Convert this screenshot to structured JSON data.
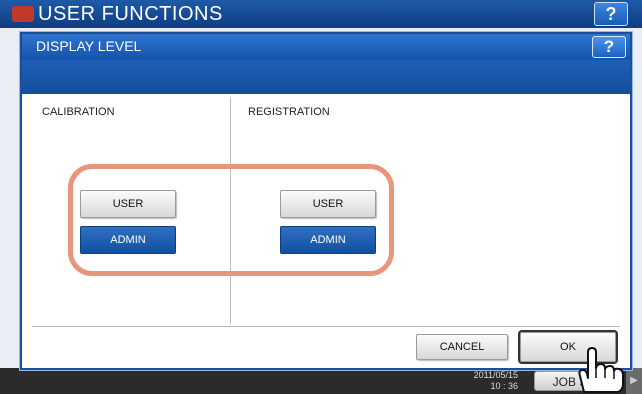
{
  "background": {
    "title": "USER FUNCTIONS",
    "help_label": "?",
    "datetime_line1": "2011/05/15",
    "datetime_line2": "10 : 36",
    "jobs_label": "JOB S",
    "arrow_icon": "triangle-right-icon"
  },
  "dialog": {
    "title": "DISPLAY LEVEL",
    "help_label": "?",
    "sections": [
      {
        "label": "CALIBRATION",
        "options": [
          {
            "label": "USER",
            "selected": false
          },
          {
            "label": "ADMIN",
            "selected": true
          }
        ]
      },
      {
        "label": "REGISTRATION",
        "options": [
          {
            "label": "USER",
            "selected": false
          },
          {
            "label": "ADMIN",
            "selected": true
          }
        ]
      }
    ],
    "cancel_label": "CANCEL",
    "ok_label": "OK"
  },
  "colors": {
    "accent_blue": "#1553ab",
    "selected_button": "#134f9e",
    "highlight_ring": "#e8957c"
  },
  "icons": {
    "pointer": "hand-pointer-icon",
    "logo": "printer-logo-icon"
  }
}
